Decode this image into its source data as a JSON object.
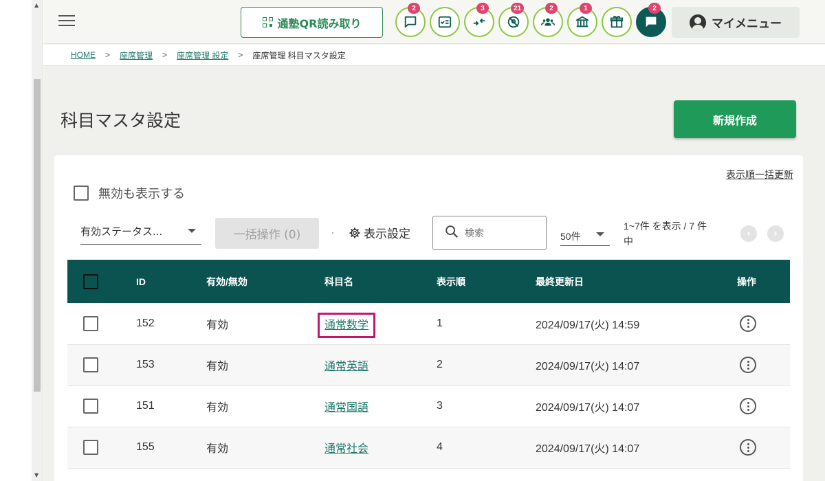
{
  "header": {
    "qr_button_label": "通塾QR読み取り",
    "icons": [
      {
        "name": "message-icon",
        "badge": "2"
      },
      {
        "name": "checklist-icon",
        "badge": ""
      },
      {
        "name": "merge-arrows-icon",
        "badge": "3"
      },
      {
        "name": "no-location-icon",
        "badge": "21"
      },
      {
        "name": "group-icon",
        "badge": "2"
      },
      {
        "name": "building-icon",
        "badge": "1"
      },
      {
        "name": "gift-icon",
        "badge": ""
      },
      {
        "name": "chat-icon",
        "badge": "2"
      }
    ],
    "mymenu_label": "マイメニュー",
    "accent_color": "#8dc63f"
  },
  "breadcrumb": {
    "home": "HOME",
    "item1": "座席管理",
    "item2": "座席管理 設定",
    "current": "座席管理 科目マスタ設定",
    "separator": ">"
  },
  "page": {
    "title": "科目マスタ設定",
    "new_button": "新規作成"
  },
  "filters": {
    "bulk_order_link": "表示順一括更新",
    "show_invalid_label": "無効も表示する",
    "status_select_value": "有効ステータス...",
    "bulk_action_label": "一括操作 (0)",
    "display_settings_label": "表示設定",
    "search_placeholder": "検索",
    "per_page_value": "50件",
    "range_info": "1~7件 を表示 / 7 件中"
  },
  "table": {
    "headers": {
      "id": "ID",
      "status": "有効/無効",
      "subject": "科目名",
      "order": "表示順",
      "updated": "最終更新日",
      "actions": "操作"
    },
    "rows": [
      {
        "id": "152",
        "status": "有効",
        "subject": "通常数学",
        "order": "1",
        "updated": "2024/09/17(火) 14:59"
      },
      {
        "id": "153",
        "status": "有効",
        "subject": "通常英語",
        "order": "2",
        "updated": "2024/09/17(火) 14:07"
      },
      {
        "id": "151",
        "status": "有効",
        "subject": "通常国語",
        "order": "3",
        "updated": "2024/09/17(火) 14:07"
      },
      {
        "id": "155",
        "status": "有効",
        "subject": "通常社会",
        "order": "4",
        "updated": "2024/09/17(火) 14:07"
      }
    ]
  },
  "colors": {
    "primary_green": "#1f9a58",
    "table_header": "#0b5350",
    "highlight": "#c5166e",
    "badge": "#e0446e"
  }
}
